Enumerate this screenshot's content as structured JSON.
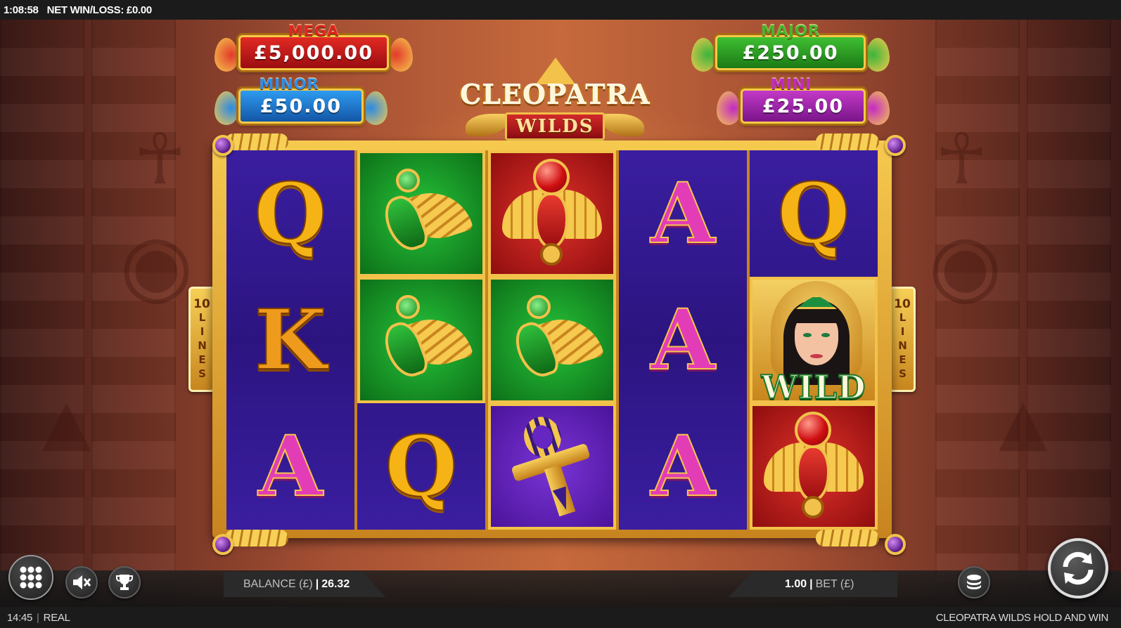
{
  "status_top": {
    "clock": "1:08:58",
    "net_label": "NET WIN/LOSS: £0.00"
  },
  "jackpots": {
    "mega": {
      "label": "MEGA",
      "amount": "£5,000.00",
      "color": "#d3191f"
    },
    "major": {
      "label": "MAJOR",
      "amount": "£250.00",
      "color": "#2ea51f"
    },
    "minor": {
      "label": "MINOR",
      "amount": "£50.00",
      "color": "#1e88e5"
    },
    "mini": {
      "label": "MINI",
      "amount": "£25.00",
      "color": "#b41fb4"
    }
  },
  "logo": {
    "title": "CLEOPATRA",
    "subtitle": "WILDS"
  },
  "paylines": {
    "count": "10",
    "word": "LINES"
  },
  "reels": [
    [
      "Q",
      "K",
      "A"
    ],
    [
      "bird",
      "bird",
      "Q"
    ],
    [
      "scarab",
      "bird",
      "ankh"
    ],
    [
      "A",
      "A",
      "A"
    ],
    [
      "Q",
      "WILD",
      "scarab"
    ]
  ],
  "wild_text": "WILD",
  "icons": {
    "menu": "menu-grid-icon",
    "sound": "sound-muted-icon",
    "trophy": "trophy-icon",
    "stake": "coin-stack-icon",
    "spin": "spin-arrows-icon"
  },
  "balance": {
    "label": "BALANCE (£)",
    "value": "26.32"
  },
  "bet": {
    "value": "1.00",
    "label": "BET (£)"
  },
  "status_bottom": {
    "session_time": "14:45",
    "mode": "REAL",
    "game_name": "CLEOPATRA WILDS HOLD AND WIN"
  }
}
